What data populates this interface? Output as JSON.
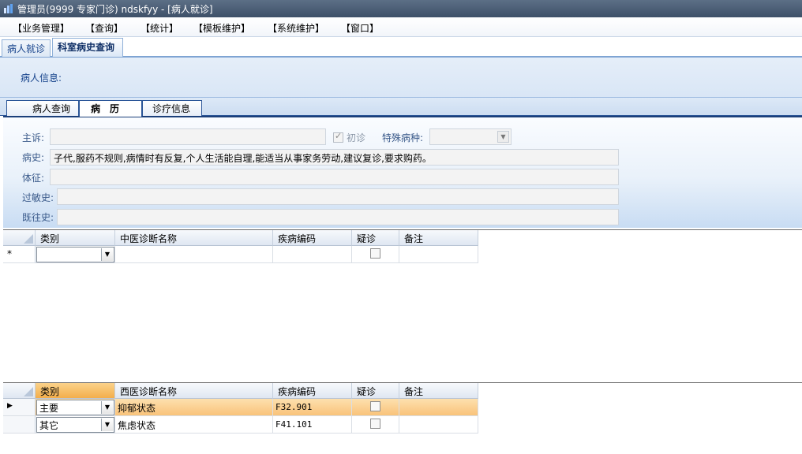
{
  "window": {
    "title": "管理员(9999 专家门诊) ndskfyy - [病人就诊]"
  },
  "menu": {
    "items": [
      "【业务管理】",
      "【查询】",
      "【统计】",
      "【模板维护】",
      "【系统维护】",
      "【窗口】"
    ]
  },
  "doc_tabs": [
    {
      "label": "病人就诊",
      "active": false
    },
    {
      "label": "科室病史查询",
      "active": true
    }
  ],
  "patient": {
    "label": "病人信息:"
  },
  "inner_tabs": [
    {
      "label": "病人查询",
      "active": false
    },
    {
      "label": "病　历",
      "active": true
    },
    {
      "label": "诊疗信息",
      "active": false
    }
  ],
  "form": {
    "chief_complaint_label": "主诉:",
    "chief_complaint_value": "",
    "first_visit_label": "初诊",
    "first_visit_checked": true,
    "special_disease_label": "特殊病种:",
    "special_disease_value": "",
    "history_label": "病史:",
    "history_value": "子代,服药不规则,病情时有反复,个人生活能自理,能适当从事家务劳动,建议复诊,要求购药。",
    "exam_label": "体征:",
    "exam_value": "",
    "allergy_label": "过敏史:",
    "allergy_value": "",
    "past_label": "既往史:",
    "past_value": ""
  },
  "tcm_grid": {
    "columns": [
      "类别",
      "中医诊断名称",
      "疾病编码",
      "疑诊",
      "备注"
    ],
    "new_row_marker": "*",
    "rows": [
      {
        "category": "",
        "name": "",
        "code": "",
        "suspect": false,
        "note": ""
      }
    ]
  },
  "wm_grid": {
    "columns": [
      "类别",
      "西医诊断名称",
      "疾病编码",
      "疑诊",
      "备注"
    ],
    "current_row_marker": "▶",
    "rows": [
      {
        "category": "主要",
        "name": "抑郁状态",
        "code": "F32.901",
        "suspect": false,
        "note": "",
        "selected": true
      },
      {
        "category": "其它",
        "name": "焦虑状态",
        "code": "F41.101",
        "suspect": false,
        "note": "",
        "selected": false
      }
    ]
  }
}
